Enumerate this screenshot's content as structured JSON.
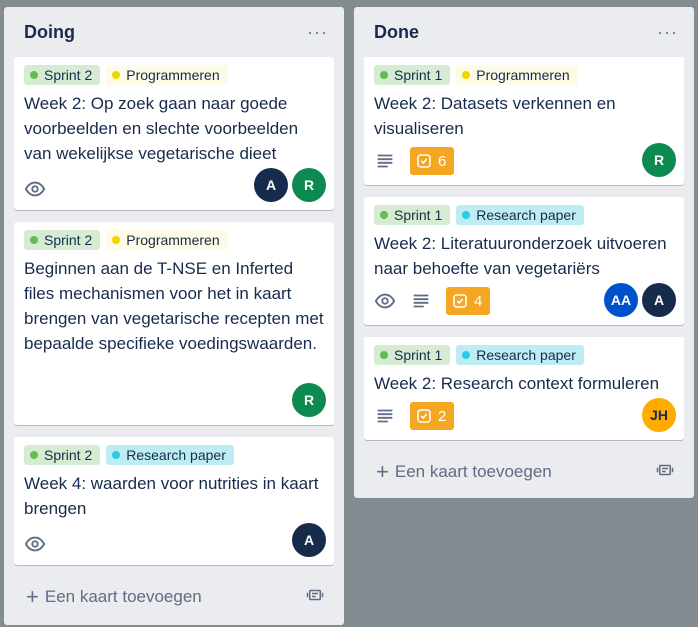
{
  "lists": [
    {
      "title": "Doing",
      "menu": "···",
      "add_card_label": "Een kaart toevoegen",
      "cards": [
        {
          "labels": [
            {
              "text": "Sprint 2",
              "color": "green"
            },
            {
              "text": "Programmeren",
              "color": "yellow"
            }
          ],
          "title": "Week 2: Op zoek gaan naar goede voorbeelden en slechte voorbeelden van wekelijkse vegetarische dieet",
          "watching": true,
          "members": [
            {
              "initials": "A"
            },
            {
              "initials": "R"
            }
          ]
        },
        {
          "labels": [
            {
              "text": "Sprint 2",
              "color": "green"
            },
            {
              "text": "Programmeren",
              "color": "yellow"
            }
          ],
          "title": "Beginnen aan de T-NSE en Inferted files mechanismen voor het in kaart brengen van vegetarische recepten met bepaalde specifieke voedingswaarden.",
          "members": [
            {
              "initials": "R"
            }
          ]
        },
        {
          "labels": [
            {
              "text": "Sprint 2",
              "color": "green"
            },
            {
              "text": "Research paper",
              "color": "blue"
            }
          ],
          "title": "Week 4: waarden voor nutrities in kaart brengen",
          "watching": true,
          "members": [
            {
              "initials": "A"
            }
          ]
        }
      ]
    },
    {
      "title": "Done",
      "menu": "···",
      "add_card_label": "Een kaart toevoegen",
      "cards": [
        {
          "labels": [
            {
              "text": "Sprint 1",
              "color": "green"
            },
            {
              "text": "Programmeren",
              "color": "yellow"
            }
          ],
          "title": "Week 2: Datasets verkennen en visualiseren",
          "has_description": true,
          "checklist": "6",
          "members": [
            {
              "initials": "R"
            }
          ]
        },
        {
          "labels": [
            {
              "text": "Sprint 1",
              "color": "green"
            },
            {
              "text": "Research paper",
              "color": "blue"
            }
          ],
          "title": "Week 2: Literatuuronderzoek uitvoeren naar behoefte van vegetariërs",
          "watching": true,
          "has_description": true,
          "checklist": "4",
          "members": [
            {
              "initials": "AA"
            },
            {
              "initials": "A"
            }
          ]
        },
        {
          "labels": [
            {
              "text": "Sprint 1",
              "color": "green"
            },
            {
              "text": "Research paper",
              "color": "blue"
            }
          ],
          "title": "Week 2: Research context formuleren",
          "has_description": true,
          "checklist": "2",
          "members": [
            {
              "initials": "JH"
            }
          ]
        }
      ]
    }
  ]
}
